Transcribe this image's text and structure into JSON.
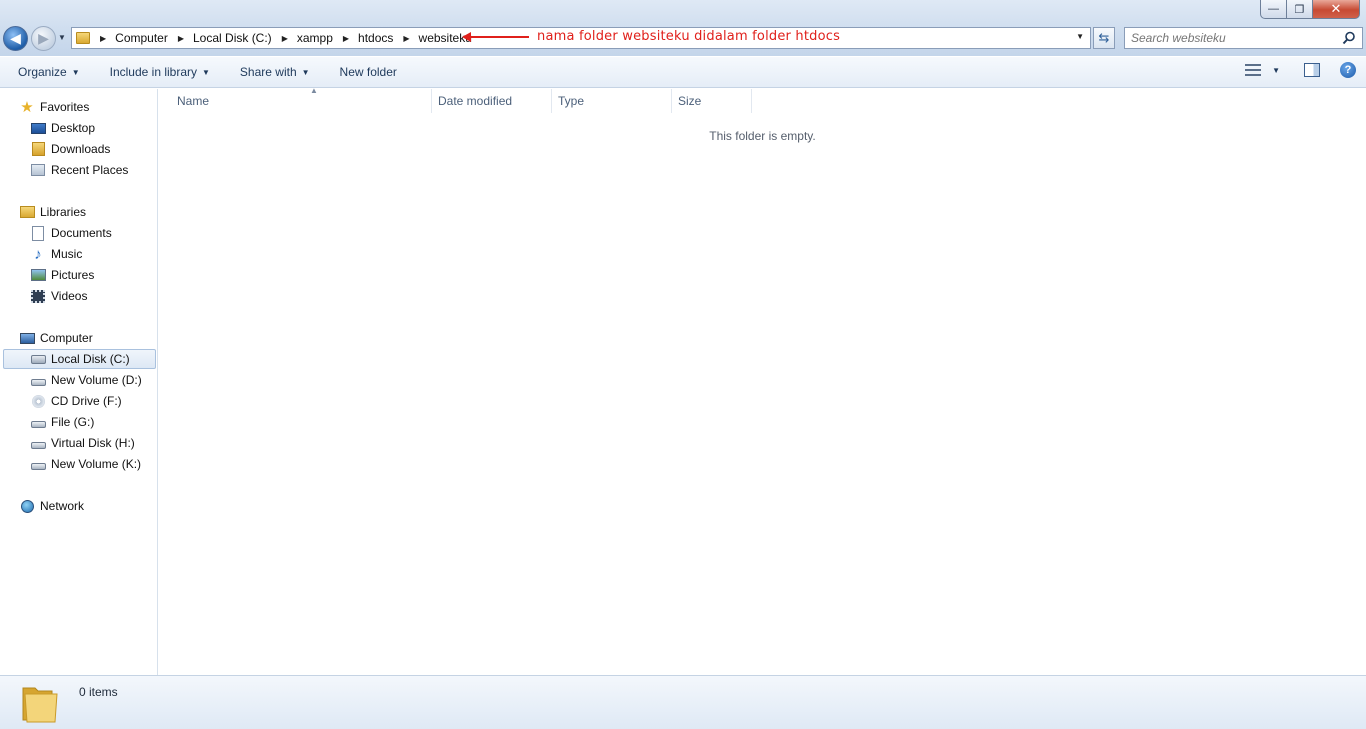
{
  "window": {
    "minimize_label": "—",
    "maximize_label": "❐",
    "close_label": "✕"
  },
  "address": {
    "crumbs": [
      "Computer",
      "Local Disk (C:)",
      "xampp",
      "htdocs",
      "websiteku"
    ],
    "annotation": "nama folder websiteku didalam folder htdocs",
    "annotation_color": "#e0201b"
  },
  "search": {
    "placeholder": "Search websiteku"
  },
  "toolbar": {
    "organize": "Organize",
    "include_in_library": "Include in library",
    "share_with": "Share with",
    "new_folder": "New folder"
  },
  "nav": {
    "favorites": "Favorites",
    "desktop": "Desktop",
    "downloads": "Downloads",
    "recent_places": "Recent Places",
    "libraries": "Libraries",
    "documents": "Documents",
    "music": "Music",
    "pictures": "Pictures",
    "videos": "Videos",
    "computer": "Computer",
    "local_disk_c": "Local Disk (C:)",
    "new_volume_d": "New Volume (D:)",
    "cd_drive_f": "CD Drive (F:)",
    "file_g": "File (G:)",
    "virtual_disk_h": "Virtual Disk (H:)",
    "new_volume_k": "New Volume (K:)",
    "network": "Network"
  },
  "columns": {
    "name": "Name",
    "date_modified": "Date modified",
    "type": "Type",
    "size": "Size"
  },
  "content": {
    "empty_message": "This folder is empty."
  },
  "details": {
    "item_count": "0 items"
  },
  "icons": {
    "back": "back-arrow-icon",
    "forward": "forward-arrow-icon",
    "refresh": "refresh-icon",
    "search": "search-icon",
    "help": "help-icon"
  }
}
